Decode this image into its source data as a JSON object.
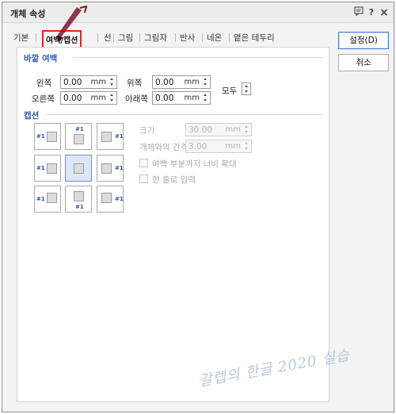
{
  "window": {
    "title": "개체 속성",
    "help_icon": "?",
    "close_icon": "×"
  },
  "tabs": [
    {
      "label": "기본",
      "active": false
    },
    {
      "label": "여백/캡션",
      "active": true
    },
    {
      "label": "선",
      "active": false
    },
    {
      "label": "그림",
      "active": false
    },
    {
      "label": "그림자",
      "active": false
    },
    {
      "label": "반사",
      "active": false
    },
    {
      "label": "네온",
      "active": false
    },
    {
      "label": "옅은 테두리",
      "active": false
    }
  ],
  "buttons": {
    "ok": "설정(D)",
    "cancel": "취소"
  },
  "margins": {
    "section_title": "바깥 여백",
    "left": {
      "label": "왼쪽",
      "value": "0.00",
      "unit": "mm"
    },
    "right": {
      "label": "오른쪽",
      "value": "0.00",
      "unit": "mm"
    },
    "top": {
      "label": "위쪽",
      "value": "0.00",
      "unit": "mm"
    },
    "bottom": {
      "label": "아래쪽",
      "value": "0.00",
      "unit": "mm"
    },
    "all_label": "모두"
  },
  "caption": {
    "section_title": "캡션",
    "tag": "#1",
    "selected_position": "none",
    "size": {
      "label": "크기",
      "value": "30.00",
      "unit": "mm"
    },
    "gap": {
      "label": "개체와의 간격",
      "value": "3.00",
      "unit": "mm"
    },
    "extend_label": "여백 부분까지 너비 확대",
    "single_line_label": "한 줄로 입력"
  },
  "annotation": {
    "sticker_text": "클릭",
    "watermark": "갈렙의 한글 2020 실습"
  },
  "colors": {
    "accent": "#2a5db0",
    "highlight": "#e8211d",
    "selected_cell": "#dbe6f8"
  }
}
